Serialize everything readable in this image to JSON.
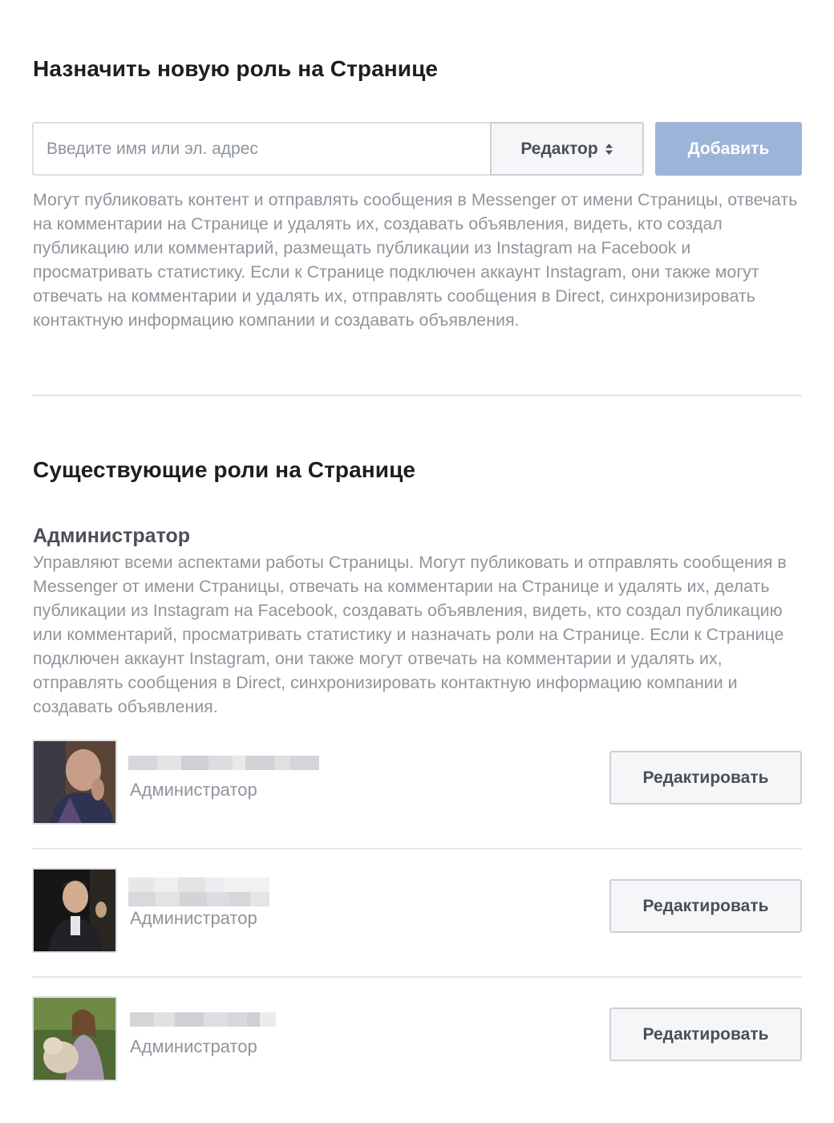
{
  "assign": {
    "title": "Назначить новую роль на Странице",
    "input_placeholder": "Введите имя или эл. адрес",
    "role_select_value": "Редактор",
    "role_select_icon": "sort-arrows-icon",
    "add_button_label": "Добавить",
    "description": "Могут публиковать контент и отправлять сообщения в Messenger от имени Страницы, отвечать на комментарии на Странице и удалять их, создавать объявления, видеть, кто создал публикацию или комментарий, размещать публикации из Instagram на Facebook и просматривать статистику. Если к Странице подключен аккаунт Instagram, они также могут отвечать на комментарии и удалять их, отправлять сообщения в Direct, синхронизировать контактную информацию компании и создавать объявления."
  },
  "existing": {
    "title": "Существующие роли на Странице",
    "admin_heading": "Администратор",
    "admin_description": "Управляют всеми аспектами работы Страницы. Могут публиковать и отправлять сообщения в Messenger от имени Страницы, отвечать на комментарии на Странице и удалять их, делать публикации из Instagram на Facebook, создавать объявления, видеть, кто создал публикацию или комментарий, просматривать статистику и назначать роли на Странице. Если к Странице подключен аккаунт Instagram, они также могут отвечать на комментарии и удалять их, отправлять сообщения в Direct, синхронизировать контактную информацию компании и создавать объявления.",
    "people": [
      {
        "role": "Администратор",
        "edit_label": "Редактировать"
      },
      {
        "role": "Администратор",
        "edit_label": "Редактировать"
      },
      {
        "role": "Администратор",
        "edit_label": "Редактировать"
      }
    ]
  },
  "colors": {
    "primary_disabled": "#9cb4d8",
    "secondary_text": "#90949c",
    "divider": "#e5e6e9"
  }
}
